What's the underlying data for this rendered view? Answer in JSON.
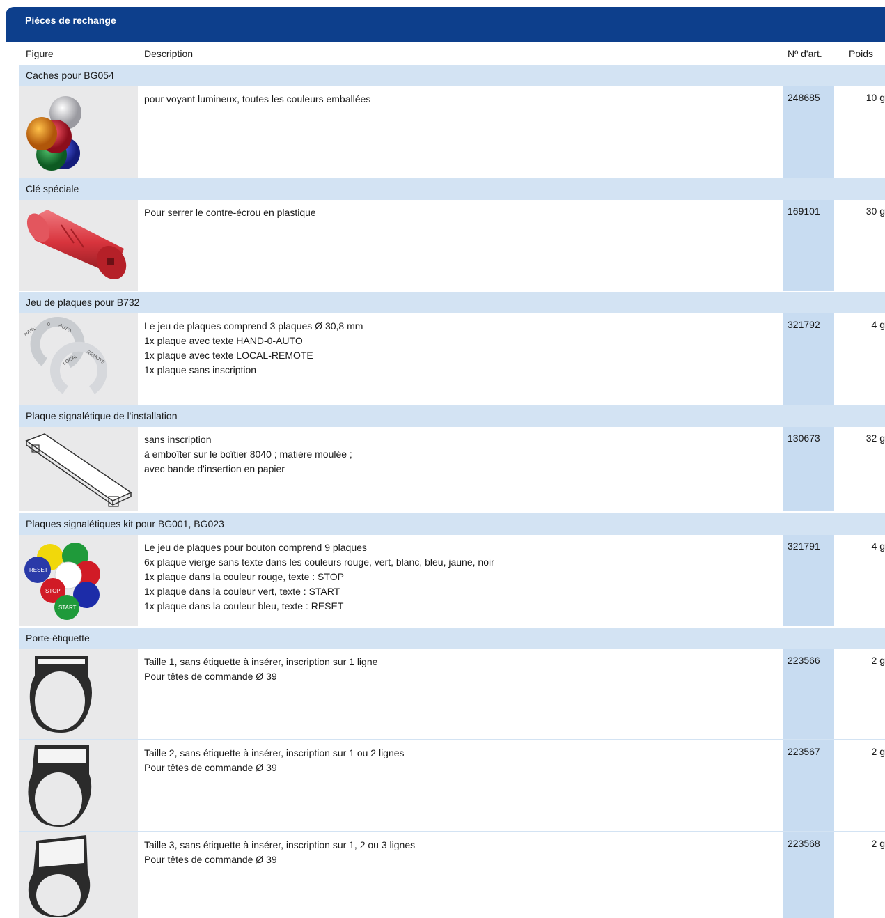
{
  "title": "Pièces de rechange",
  "columns": {
    "figure": "Figure",
    "description": "Description",
    "article": "Nº d'art.",
    "weight": "Poids"
  },
  "sections": [
    {
      "title": "Caches pour BG054",
      "rows": [
        {
          "icon": "lens-caps-icon",
          "description": "pour voyant lumineux, toutes les couleurs emballées",
          "article": "248685",
          "weight": "10 g"
        }
      ]
    },
    {
      "title": "Clé spéciale",
      "rows": [
        {
          "icon": "special-key-icon",
          "description": "Pour serrer le contre-écrou en plastique",
          "article": "169101",
          "weight": "30 g"
        }
      ]
    },
    {
      "title": "Jeu de plaques pour B732",
      "rows": [
        {
          "icon": "plate-set-icon",
          "description": "Le jeu de plaques comprend 3 plaques Ø 30,8 mm\n1x plaque avec texte HAND-0-AUTO\n1x plaque avec texte LOCAL-REMOTE\n1x plaque sans inscription",
          "article": "321792",
          "weight": "4 g"
        }
      ]
    },
    {
      "title": "Plaque signalétique de l'installation",
      "rows": [
        {
          "icon": "nameplate-icon",
          "description": "sans inscription\nà emboîter sur le boîtier 8040 ; matière moulée ;\navec bande d'insertion en papier",
          "article": "130673",
          "weight": "32 g"
        }
      ]
    },
    {
      "title": "Plaques signalétiques kit pour BG001, BG023",
      "rows": [
        {
          "icon": "button-plates-icon",
          "description": "Le jeu de plaques pour bouton comprend 9 plaques\n6x plaque vierge sans texte dans les couleurs rouge, vert, blanc, bleu, jaune, noir\n1x plaque dans la couleur rouge, texte : STOP\n1x plaque dans la couleur vert, texte : START\n1x plaque dans la couleur bleu, texte : RESET",
          "article": "321791",
          "weight": "4 g"
        }
      ]
    },
    {
      "title": "Porte-étiquette",
      "rows": [
        {
          "icon": "label-holder-icon",
          "description": "Taille 1, sans étiquette à insérer, inscription sur 1 ligne\nPour têtes de commande Ø 39",
          "article": "223566",
          "weight": "2 g"
        },
        {
          "icon": "label-holder-icon",
          "description": "Taille 2, sans étiquette à insérer, inscription sur 1 ou 2 lignes\nPour têtes de commande Ø 39",
          "article": "223567",
          "weight": "2 g"
        },
        {
          "icon": "label-holder-icon",
          "description": "Taille 3, sans étiquette à insérer, inscription sur 1, 2 ou 3 lignes\nPour têtes de commande Ø 39",
          "article": "223568",
          "weight": "2 g"
        }
      ]
    }
  ],
  "figure_labels": {
    "plate_hand": "HAND",
    "plate_zero": "0",
    "plate_auto": "AUTO",
    "plate_local": "LOCAL",
    "plate_remote": "REMOTE",
    "btn_reset": "RESET",
    "btn_stop": "STOP",
    "btn_start": "START"
  },
  "colors": {
    "header_blue": "#0d3f8c",
    "section_blue": "#d3e3f3",
    "article_blue": "#c8dcf1",
    "figure_grey": "#e9e9ea"
  }
}
